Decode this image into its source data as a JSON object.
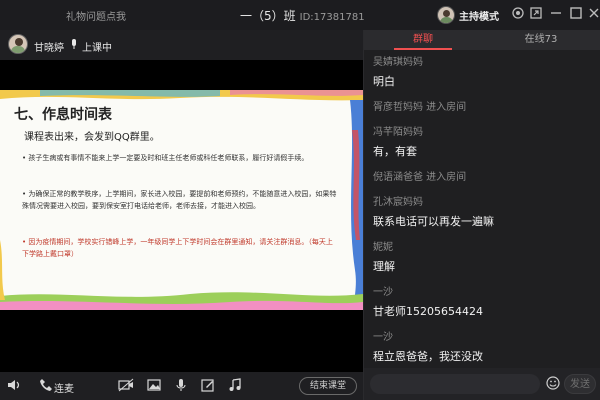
{
  "titlebar": {
    "help_text": "礼物问题点我",
    "class_name": "一（5）班",
    "class_id": "ID:17381781",
    "mode": "主持模式"
  },
  "teacher": {
    "name": "甘晓婷",
    "status": "上课中"
  },
  "slide": {
    "title": "七、作息时间表",
    "subtitle": "课程表出来，会发到QQ群里。",
    "paragraphs": [
      "• 孩子生病或有事情不能来上学一定要及时和班主任老师或科任老师联系，履行好请假手续。",
      "• 为确保正常的教学秩序，上学期间，家长进入校园，要提前和老师预约，不能随意进入校园，如果特殊情况需要进入校园，要到保安室打电话给老师，老师去接，才能进入校园。",
      "• 因为疫情期间，学校实行错峰上学，一年级同学上下学时间会在群里通知，请关注群消息。（每天上下学路上戴口罩）"
    ]
  },
  "toolbar": {
    "connect_label": "连麦",
    "end_class": "结束课堂"
  },
  "tabs": {
    "discussion": "群聊",
    "online": "在线73"
  },
  "chat": {
    "messages": [
      {
        "sender": "吴婧琪妈妈",
        "text": "明白"
      },
      {
        "system": "胥彦哲妈妈 进入房间"
      },
      {
        "sender": "冯芊陌妈妈",
        "text": "有，有套"
      },
      {
        "system": "倪语涵爸爸 进入房间"
      },
      {
        "sender": "孔沐宸妈妈",
        "text": "联系电话可以再发一遍嘛"
      },
      {
        "sender": "妮妮",
        "text": "理解"
      },
      {
        "sender": "一沙",
        "text": "甘老师15205654424"
      },
      {
        "sender": "一沙",
        "text": "程立恩爸爸，我还没改"
      }
    ],
    "send_label": "发送"
  },
  "colors": {
    "accent": "#f05050",
    "background": "#1b1b1d",
    "slide_bg": "#fbfbf7"
  }
}
